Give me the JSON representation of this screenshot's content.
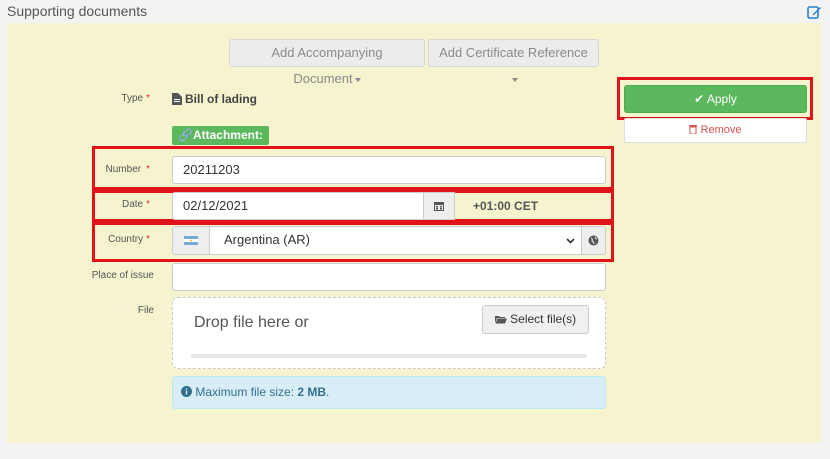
{
  "section": {
    "title": "Supporting documents"
  },
  "toolbar": {
    "add_accompanying": "Add Accompanying Document",
    "add_certificate": "Add Certificate Reference"
  },
  "form": {
    "type_label": "Type",
    "type_value": "Bill of lading",
    "attachment_label": "Attachment:",
    "number_label": "Number",
    "number_value": "20211203",
    "date_label": "Date",
    "date_value": "02/12/2021",
    "timezone": "+01:00 CET",
    "country_label": "Country",
    "country_value": "Argentina (AR)",
    "place_label": "Place of issue",
    "place_value": "",
    "file_label": "File",
    "required_mark": "*"
  },
  "actions": {
    "apply": "Apply",
    "remove": "Remove"
  },
  "file": {
    "drop_text": "Drop file here or",
    "select_button": "Select file(s)",
    "info_prefix": "Maximum file size: ",
    "info_value": "2 MB",
    "info_suffix": "."
  },
  "colors": {
    "highlight": "#e2121b",
    "success": "#5cb85c",
    "danger": "#d9534f",
    "panel": "#f5f4cf"
  }
}
